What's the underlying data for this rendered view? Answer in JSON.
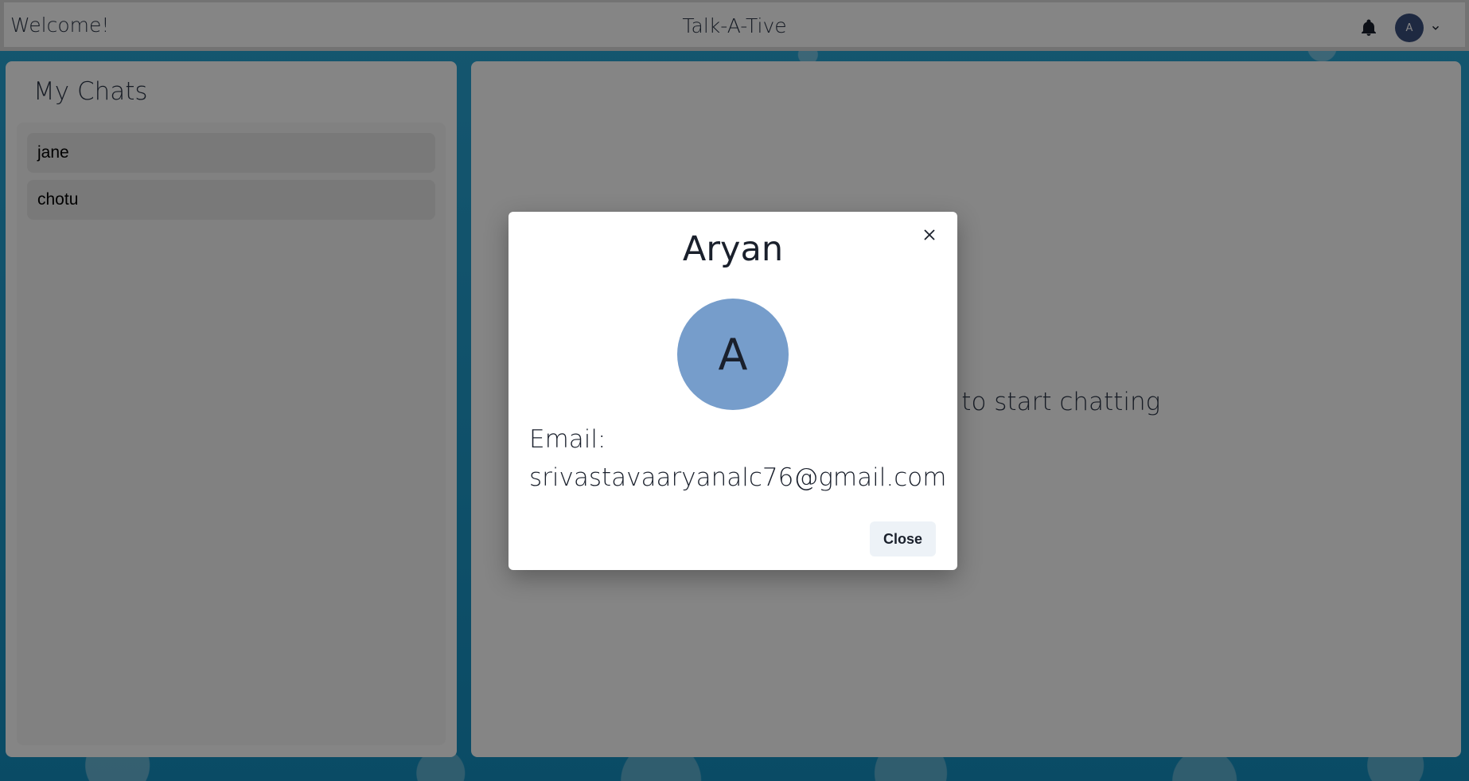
{
  "header": {
    "welcome": "Welcome!",
    "brand": "Talk-A-Tive",
    "user_initial": "A"
  },
  "sidebar": {
    "title": "My Chats",
    "chats": [
      {
        "name": "jane"
      },
      {
        "name": "chotu"
      }
    ]
  },
  "main": {
    "hint": "Click on a user to start chatting"
  },
  "modal": {
    "name": "Aryan",
    "avatar_initial": "A",
    "email_label": "Email:",
    "email": "srivastavaaryanalc76@gmail.com",
    "close_label": "Close"
  },
  "colors": {
    "avatar_bg": "#769dcb",
    "mini_avatar_bg": "#3b4f7d"
  }
}
